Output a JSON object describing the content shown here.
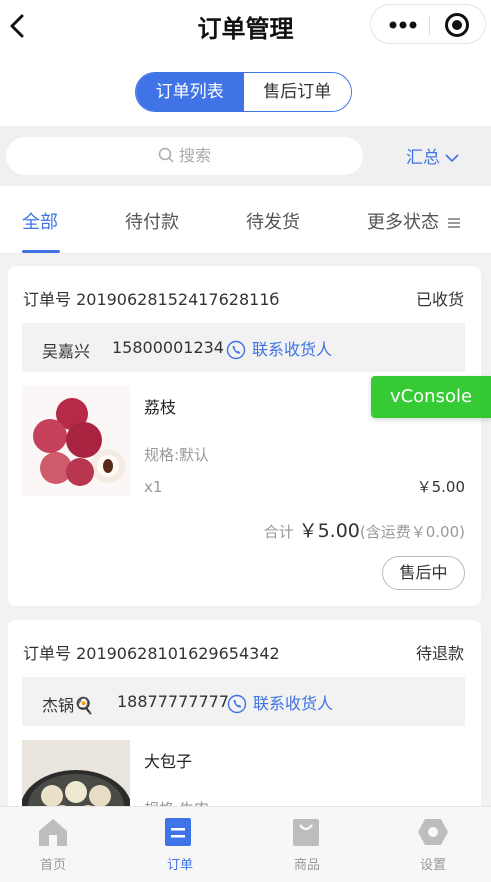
{
  "nav": {
    "title": "订单管理",
    "back_icon": "back-arrow-icon",
    "more_icon": "more-dots-icon",
    "close_icon": "target-close-icon"
  },
  "segment": {
    "options": [
      "订单列表",
      "售后订单"
    ],
    "active": "订单列表"
  },
  "search": {
    "placeholder": "搜索",
    "summary_label": "汇总",
    "accent": "#3f73e6"
  },
  "status_tabs": {
    "items": [
      "全部",
      "待付款",
      "待发货",
      "更多状态"
    ],
    "active": "全部"
  },
  "orders": [
    {
      "order_no_label": "订单号 2019062815241762811б",
      "status": "已收货",
      "receiver_name": "吴嘉兴",
      "receiver_phone": "15800001234",
      "contact_label": "联系收货人",
      "product_name": "荔枝",
      "spec": "规格:默认",
      "qty": "x1",
      "price": "￥5.00",
      "total_label": "合计",
      "total_amount": "￥5.00",
      "total_note": "(含运费￥0.00)",
      "action_label": "售后中"
    },
    {
      "order_no_label": "订单号 20190628101629654342",
      "status": "待退款",
      "receiver_name": "杰锅🍳",
      "receiver_phone": "18877777777",
      "contact_label": "联系收货人",
      "product_name": "大包子",
      "spec": "规格:牛肉"
    }
  ],
  "vconsole": {
    "label": "vConsole",
    "color": "#04be02"
  },
  "tabbar": {
    "items": [
      "首页",
      "订单",
      "商品",
      "设置"
    ],
    "active": "订单"
  }
}
